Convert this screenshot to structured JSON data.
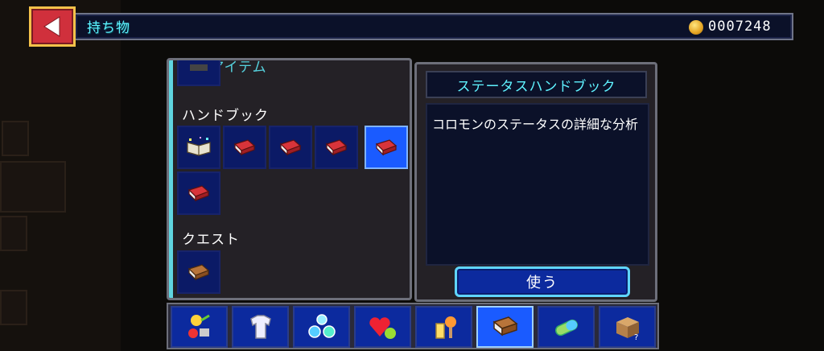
{
  "header": {
    "title": "持ち物",
    "money": "0007248"
  },
  "inventory": {
    "section_key_items": "キーアイテム",
    "section_handbook": "ハンドブック",
    "section_quest": "クエスト"
  },
  "detail": {
    "title": "ステータスハンドブック",
    "description": "コロモンのステータスの詳細な分析",
    "use_label": "使う"
  },
  "icons": {
    "back": "back-arrow-icon",
    "coin": "coin-icon",
    "open_book": "open-book-icon",
    "red_book": "red-book-icon",
    "brown_book": "brown-book-icon"
  },
  "tabs": [
    {
      "icon": "food-items-icon",
      "active": false
    },
    {
      "icon": "shirt-icon",
      "active": false
    },
    {
      "icon": "orbs-icon",
      "active": false
    },
    {
      "icon": "heart-fruit-icon",
      "active": false
    },
    {
      "icon": "potion-icon",
      "active": false
    },
    {
      "icon": "book-icon",
      "active": true
    },
    {
      "icon": "capsule-icon",
      "active": false
    },
    {
      "icon": "mystery-box-icon",
      "active": false
    }
  ],
  "colors": {
    "accent_cyan": "#5ff2ff",
    "slot_blue": "#0b1a66",
    "selected_blue": "#1a5bff",
    "back_red": "#d0303c"
  }
}
